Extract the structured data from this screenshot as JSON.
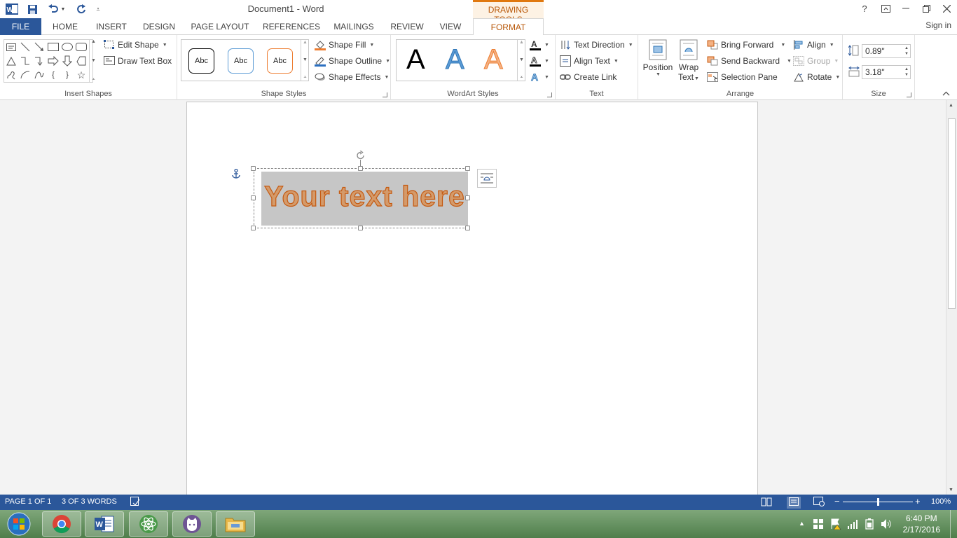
{
  "window": {
    "title": "Document1 - Word",
    "contextual_tab_group": "DRAWING TOOLS",
    "help": "?",
    "sign_in": "Sign in"
  },
  "tabs": [
    "FILE",
    "HOME",
    "INSERT",
    "DESIGN",
    "PAGE LAYOUT",
    "REFERENCES",
    "MAILINGS",
    "REVIEW",
    "VIEW",
    "FORMAT"
  ],
  "ribbon": {
    "insert_shapes": {
      "label": "Insert Shapes",
      "edit_shape": "Edit Shape",
      "draw_text_box": "Draw Text Box"
    },
    "shape_styles": {
      "label": "Shape Styles",
      "samples": [
        "Abc",
        "Abc",
        "Abc"
      ],
      "shape_fill": "Shape Fill",
      "shape_outline": "Shape Outline",
      "shape_effects": "Shape Effects"
    },
    "wordart_styles": {
      "label": "WordArt Styles",
      "samples": [
        "A",
        "A",
        "A"
      ]
    },
    "text": {
      "label": "Text",
      "text_direction": "Text Direction",
      "align_text": "Align Text",
      "create_link": "Create Link"
    },
    "arrange": {
      "label": "Arrange",
      "position": "Position",
      "wrap_text_1": "Wrap",
      "wrap_text_2": "Text",
      "bring_forward": "Bring Forward",
      "send_backward": "Send Backward",
      "selection_pane": "Selection Pane",
      "align": "Align",
      "group": "Group",
      "rotate": "Rotate"
    },
    "size": {
      "label": "Size",
      "height": "0.89\"",
      "width": "3.18\""
    }
  },
  "document": {
    "wordart_text": "Your text here"
  },
  "status": {
    "page": "PAGE 1 OF 1",
    "words": "3 OF 3 WORDS",
    "zoom": "100%",
    "zoom_fraction": 0.5
  },
  "taskbar": {
    "time": "6:40 PM",
    "date": "2/17/2016"
  },
  "colors": {
    "accent_blue": "#2b579a",
    "drawing_tools_orange": "#e0780f",
    "wordart_outline": "#c55a11"
  }
}
